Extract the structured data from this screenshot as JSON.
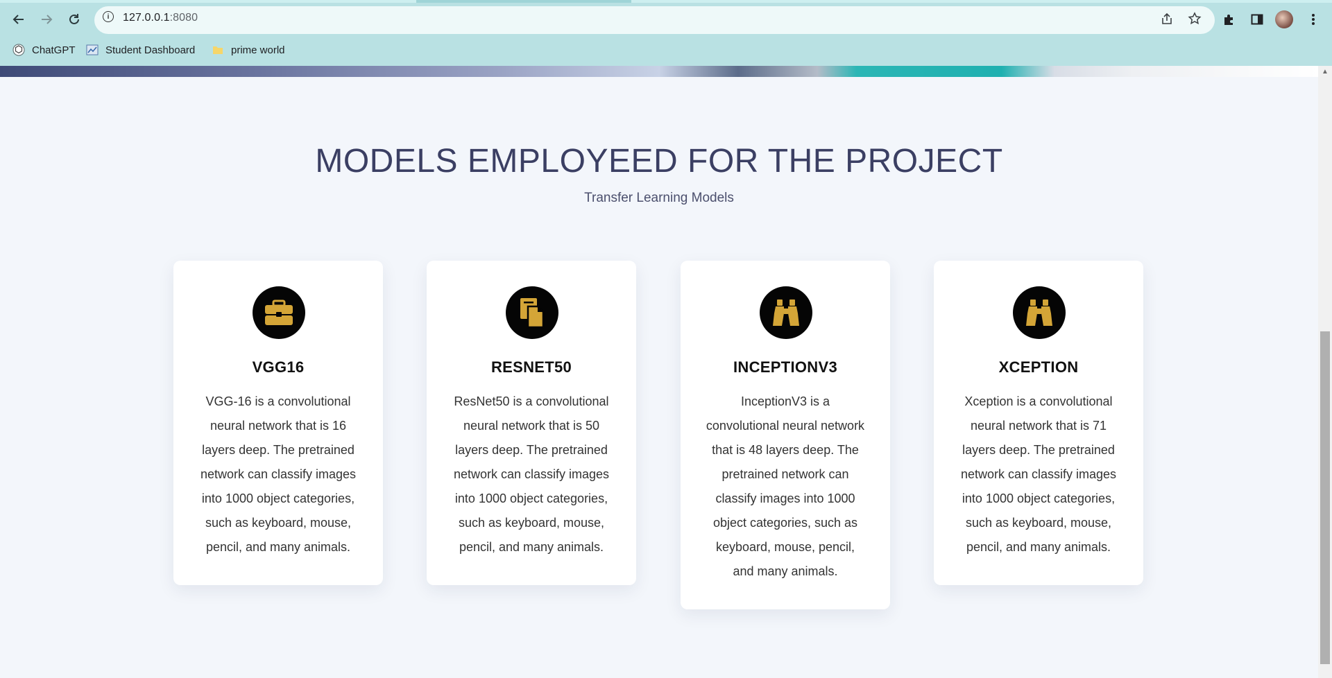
{
  "browser": {
    "url_host": "127.0.0.1",
    "url_port": ":8080",
    "bookmarks": [
      {
        "label": "ChatGPT",
        "icon": "chatgpt-icon"
      },
      {
        "label": "Student Dashboard",
        "icon": "dashboard-icon"
      },
      {
        "label": "prime world",
        "icon": "folder-icon"
      }
    ]
  },
  "section": {
    "title": "MODELS EMPLOYEED FOR THE PROJECT",
    "subtitle": "Transfer Learning Models"
  },
  "cards": [
    {
      "title": "VGG16",
      "icon": "briefcase-icon",
      "text": "VGG-16 is a convolutional neural network that is 16 layers deep. The pretrained network can classify images into 1000 object categories, such as keyboard, mouse, pencil, and many animals."
    },
    {
      "title": "RESNET50",
      "icon": "document-icon",
      "text": "ResNet50 is a convolutional neural network that is 50 layers deep. The pretrained network can classify images into 1000 object categories, such as keyboard, mouse, pencil, and many animals."
    },
    {
      "title": "INCEPTIONV3",
      "icon": "binoculars-icon",
      "text": "InceptionV3 is a convolutional neural network that is 48 layers deep. The pretrained network can classify images into 1000 object categories, such as keyboard, mouse, pencil, and many animals."
    },
    {
      "title": "XCEPTION",
      "icon": "binoculars-icon",
      "text": "Xception is a convolutional neural network that is 71 layers deep. The pretrained network can classify images into 1000 object categories, such as keyboard, mouse, pencil, and many animals."
    }
  ],
  "colors": {
    "icon_gold": "#d4a537",
    "title_navy": "#3b3f63",
    "chrome_teal": "#b9e1e3"
  }
}
